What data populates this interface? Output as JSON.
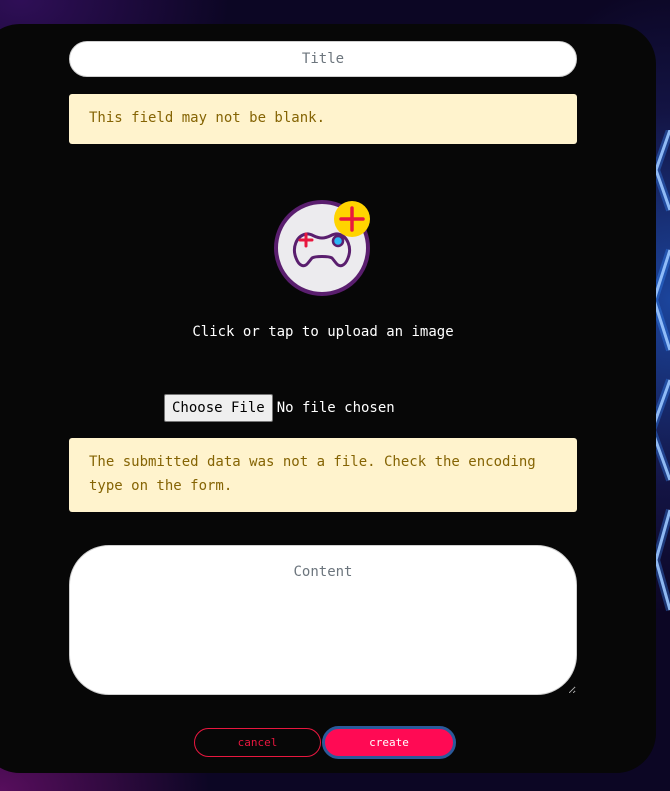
{
  "form": {
    "title_placeholder": "Title",
    "title_value": "",
    "title_error": "This field may not be blank.",
    "upload": {
      "icon": "gamepad-add-icon",
      "caption": "Click or tap to upload an image",
      "button_label": "Choose File",
      "status": "No file chosen",
      "error": "The submitted data was not a file. Check the encoding type on the form."
    },
    "content_placeholder": "Content",
    "content_value": "",
    "actions": {
      "cancel_label": "cancel",
      "create_label": "create"
    }
  },
  "colors": {
    "card_background": "#070707",
    "alert_background": "#fff3cd",
    "alert_text": "#856404",
    "cancel_accent": "#e8173f",
    "create_background": "#ff0a54",
    "create_border": "#2a5a9a",
    "icon_badge": "#ffd400",
    "icon_ring": "#5a1e6e"
  }
}
